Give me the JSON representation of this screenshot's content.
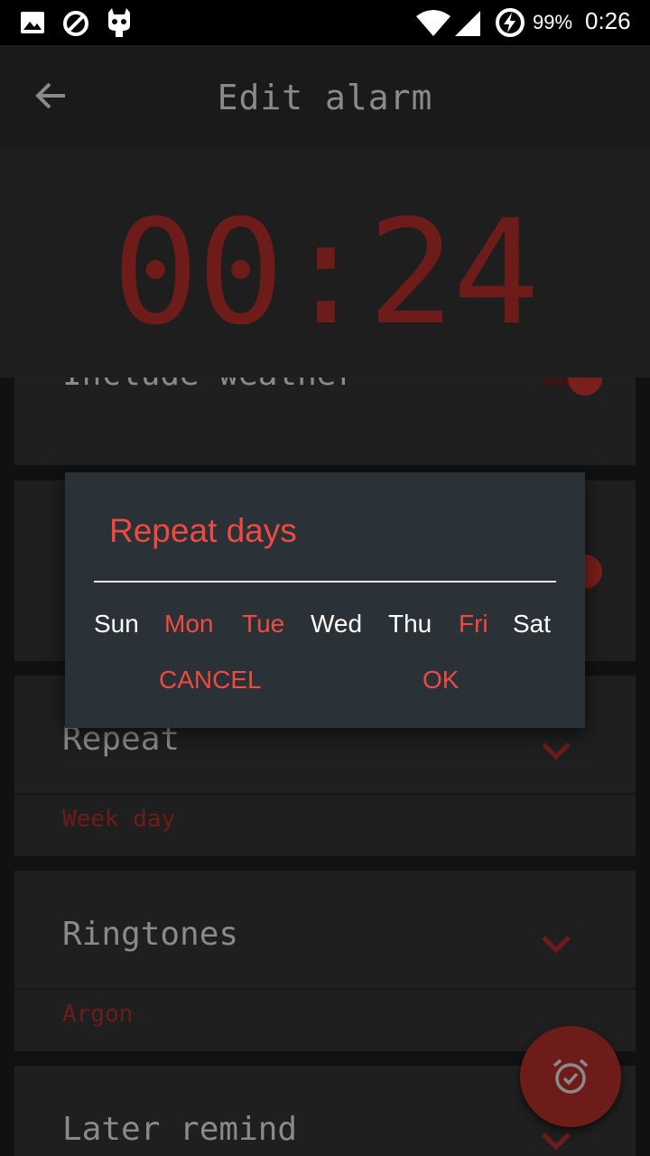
{
  "status_bar": {
    "battery_percent": "99%",
    "time": "0:26",
    "icons": [
      "image-icon",
      "do-not-disturb-icon",
      "cyanogen-icon",
      "wifi-icon",
      "signal-icon",
      "battery-charging-icon"
    ]
  },
  "app_bar": {
    "title": "Edit alarm",
    "back_icon": "arrow-back-icon"
  },
  "alarm": {
    "time": "00:24"
  },
  "settings": {
    "weather_label": "Include weather",
    "repeat_label": "Repeat",
    "repeat_value": "Week day",
    "ringtones_label": "Ringtones",
    "ringtone_value": "Argon",
    "later_remind_label": "Later remind"
  },
  "dialog": {
    "title": "Repeat days",
    "days": [
      {
        "label": "Sun",
        "selected": false
      },
      {
        "label": "Mon",
        "selected": true
      },
      {
        "label": "Tue",
        "selected": true
      },
      {
        "label": "Wed",
        "selected": false
      },
      {
        "label": "Thu",
        "selected": false
      },
      {
        "label": "Fri",
        "selected": true
      },
      {
        "label": "Sat",
        "selected": false
      }
    ],
    "cancel_label": "CANCEL",
    "ok_label": "OK"
  },
  "fab": {
    "icon": "alarm-check-icon"
  },
  "colors": {
    "accent": "#ef4a40",
    "dim_accent": "#6e1c1a",
    "dialog_bg": "#2a3137"
  }
}
